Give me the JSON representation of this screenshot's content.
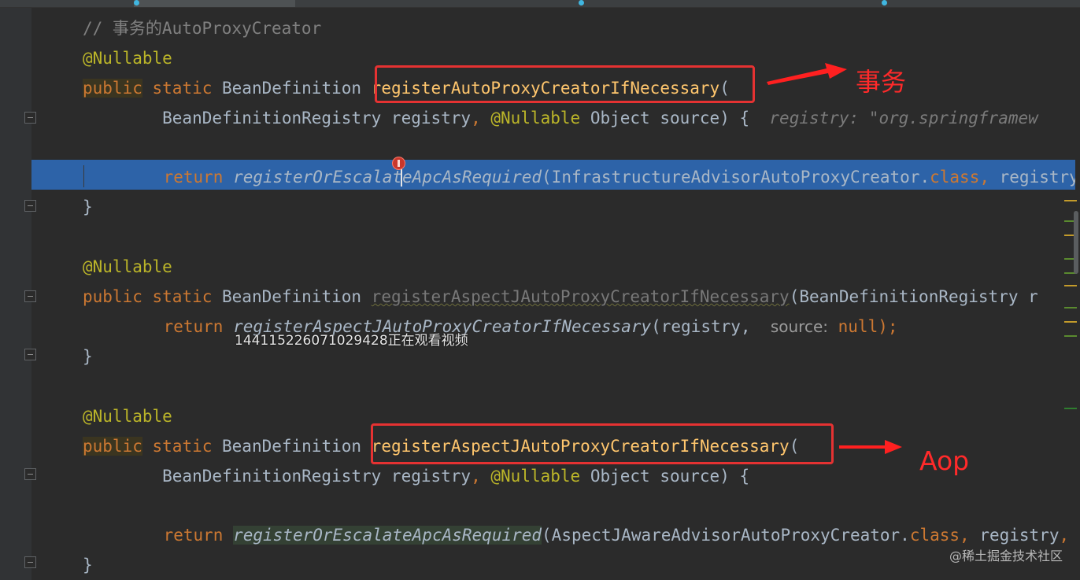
{
  "editor": {
    "lines": [
      {
        "id": "comment",
        "parts": [
          {
            "t": "// 事务的AutoProxyCreator",
            "c": "cmt"
          }
        ]
      },
      {
        "id": "ann1",
        "parts": [
          {
            "t": "@Nullable",
            "c": "ann"
          }
        ]
      },
      {
        "id": "sig1",
        "parts": [
          {
            "t": "public",
            "c": "kw bg-brown"
          },
          {
            "t": " "
          },
          {
            "t": "static",
            "c": "kw"
          },
          {
            "t": " BeanDefinition "
          },
          {
            "t": "registerAutoProxyCreatorIfNecessary",
            "c": "m"
          },
          {
            "t": "("
          }
        ]
      },
      {
        "id": "params1",
        "parts": [
          {
            "t": "        BeanDefinitionRegistry registry"
          },
          {
            "t": ", ",
            "c": "kw"
          },
          {
            "t": "@Nullable",
            "c": "ann"
          },
          {
            "t": " Object source) {  "
          },
          {
            "t": "registry: \"org.springframew",
            "c": "grayit"
          }
        ]
      },
      {
        "id": "blank1",
        "parts": []
      },
      {
        "id": "return1",
        "parts": [
          {
            "t": "    "
          },
          {
            "t": "return",
            "c": "kw"
          },
          {
            "t": " "
          },
          {
            "t": "registerOrEscalateApcAsRequired",
            "c": "it"
          },
          {
            "t": "(InfrastructureAdvisorAutoProxyCreator."
          },
          {
            "t": "class",
            "c": "kw"
          },
          {
            "t": ", ",
            "c": "kw"
          },
          {
            "t": "registry"
          }
        ]
      },
      {
        "id": "close1",
        "parts": [
          {
            "t": "}"
          }
        ]
      },
      {
        "id": "blank2",
        "parts": []
      },
      {
        "id": "ann2",
        "parts": [
          {
            "t": "@Nullable",
            "c": "ann"
          }
        ]
      },
      {
        "id": "sig2",
        "parts": [
          {
            "t": "public",
            "c": "kw"
          },
          {
            "t": " "
          },
          {
            "t": "static",
            "c": "kw"
          },
          {
            "t": " BeanDefinition "
          },
          {
            "t": "registerAspectJAutoProxyCreatorIfNecessary",
            "c": "dim squig"
          },
          {
            "t": "(BeanDefinitionRegistry r"
          }
        ]
      },
      {
        "id": "return2",
        "parts": [
          {
            "t": "    "
          },
          {
            "t": "return",
            "c": "kw"
          },
          {
            "t": " "
          },
          {
            "t": "registerAspectJAutoProxyCreatorIfNecessary",
            "c": "it"
          },
          {
            "t": "(registry,  "
          },
          {
            "t": "source:",
            "c": "hint"
          },
          {
            "t": " "
          },
          {
            "t": "null",
            "c": "kw"
          },
          {
            "t": ");",
            "c": "kw"
          }
        ]
      },
      {
        "id": "close2",
        "parts": [
          {
            "t": "}"
          }
        ]
      },
      {
        "id": "blank3",
        "parts": []
      },
      {
        "id": "ann3",
        "parts": [
          {
            "t": "@Nullable",
            "c": "ann"
          }
        ]
      },
      {
        "id": "sig3",
        "parts": [
          {
            "t": "public",
            "c": "kw bg-brown"
          },
          {
            "t": " "
          },
          {
            "t": "static",
            "c": "kw"
          },
          {
            "t": " BeanDefinition "
          },
          {
            "t": "registerAspectJAutoProxyCreatorIfNecessary",
            "c": "m"
          },
          {
            "t": "("
          }
        ]
      },
      {
        "id": "params3",
        "parts": [
          {
            "t": "        BeanDefinitionRegistry registry"
          },
          {
            "t": ", ",
            "c": "kw"
          },
          {
            "t": "@Nullable",
            "c": "ann"
          },
          {
            "t": " Object source) {"
          }
        ]
      },
      {
        "id": "blank4",
        "parts": []
      },
      {
        "id": "return3",
        "parts": [
          {
            "t": "    "
          },
          {
            "t": "return",
            "c": "kw"
          },
          {
            "t": " "
          },
          {
            "t": "registerOrEscalateApcAsRequired",
            "c": "it bg-green"
          },
          {
            "t": "(AspectJAwareAdvisorAutoProxyCreator."
          },
          {
            "t": "class",
            "c": "kw"
          },
          {
            "t": ", ",
            "c": "kw"
          },
          {
            "t": "registry"
          },
          {
            "t": ", ",
            "c": "kw"
          },
          {
            "t": "s"
          }
        ]
      },
      {
        "id": "close3",
        "parts": [
          {
            "t": "}"
          }
        ]
      }
    ]
  },
  "annotations": {
    "label_tx": "事务",
    "label_aop": "Aop"
  },
  "overlay_text": "1441152260710294​28正在观看视频",
  "watermark": "@稀土掘金技术社区",
  "colors": {
    "background": "#2b2b2b",
    "keyword": "#cc7832",
    "annotation": "#bbb529",
    "method": "#ffc66d",
    "selection": "#2d63a8",
    "callout": "#e53232"
  }
}
